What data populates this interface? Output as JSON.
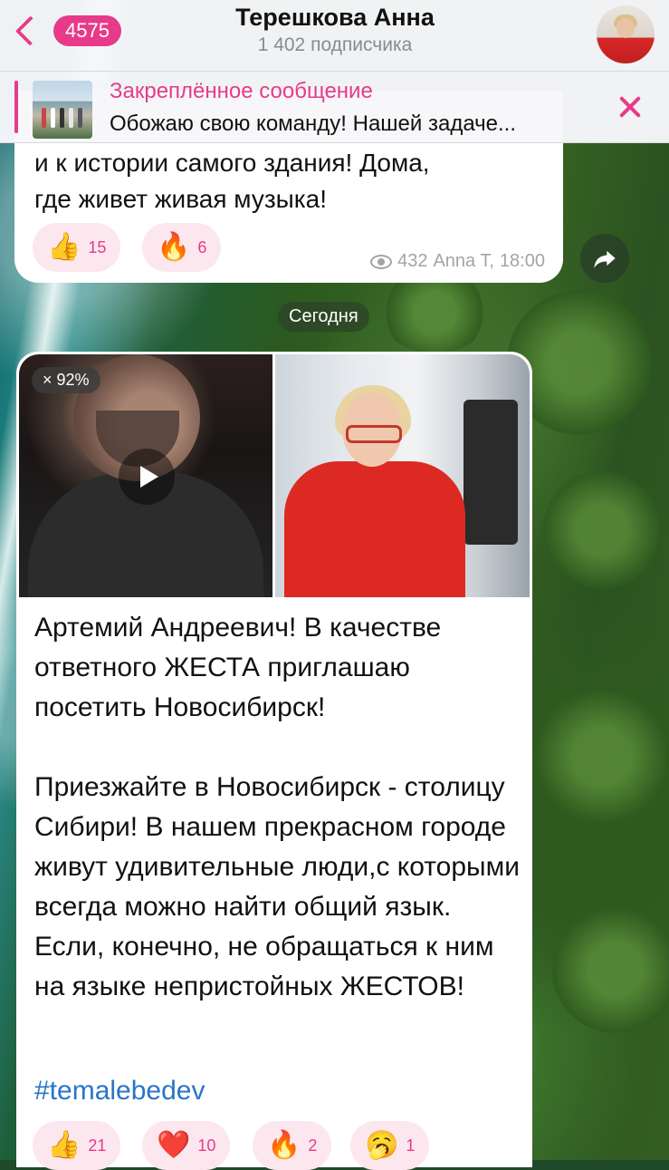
{
  "header": {
    "back_count": "4575",
    "title": "Терешкова Анна",
    "subtitle": "1 402 подписчика"
  },
  "pinned": {
    "title": "Закреплённое сообщение",
    "text": "Обожаю свою команду! Нашей задаче..."
  },
  "message_prev": {
    "text_partial": "и к истории самого здания! Дома,\nгде живет живая музыка!",
    "reactions": [
      {
        "emoji": "👍",
        "count": "15"
      },
      {
        "emoji": "🔥",
        "count": "6"
      }
    ],
    "views": "432",
    "author": "Anna T,",
    "time": "18:00"
  },
  "date_separator": "Сегодня",
  "message": {
    "video_speed": "× 92%",
    "text": "Артемий Андреевич! В качестве ответного ЖЕСТА приглашаю посетить Новосибирск!\n\nПриезжайте в Новосибирск - столицу Сибири! В нашем прекрасном городе живут удивительные  люди,с которыми всегда можно найти общий язык. Если, конечно, не обращаться к ним на языке непристойных ЖЕСТОВ!",
    "hashtag": "#temalebedev",
    "reactions": [
      {
        "emoji": "👍",
        "count": "21"
      },
      {
        "emoji": "❤️",
        "count": "10"
      },
      {
        "emoji": "🔥",
        "count": "2"
      },
      {
        "emoji": "🥱",
        "count": "1"
      }
    ]
  },
  "colors": {
    "accent": "#e83a8a",
    "reaction_bg": "#fde7ee",
    "link": "#2a74c8"
  }
}
